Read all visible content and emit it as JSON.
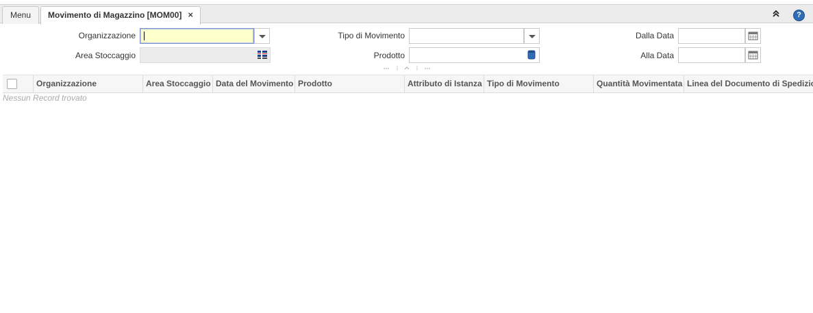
{
  "tabs": {
    "menu_label": "Menu",
    "active_label": "Movimento di Magazzino [MOM00]",
    "close_glyph": "×"
  },
  "window_controls": {
    "collapse_icon": "double-chevron-up-icon",
    "help_icon": "help-icon",
    "collapse_glyph": "»",
    "help_glyph": "?"
  },
  "form": {
    "organizzazione_label": "Organizzazione",
    "organizzazione_value": "",
    "area_stoccaggio_label": "Area Stoccaggio",
    "area_stoccaggio_value": "",
    "tipo_movimento_label": "Tipo di Movimento",
    "tipo_movimento_value": "",
    "prodotto_label": "Prodotto",
    "prodotto_value": "",
    "dalla_data_label": "Dalla Data",
    "dalla_data_value": "",
    "alla_data_label": "Alla Data",
    "alla_data_value": ""
  },
  "grid": {
    "columns": [
      "Organizzazione",
      "Area Stoccaggio",
      "Data del Movimento",
      "Prodotto",
      "Attributo di Istanza",
      "Tipo di Movimento",
      "Quantità Movimentata",
      "Linea del Documento di Spedizione"
    ],
    "empty_message": "Nessun Record trovato"
  },
  "colors": {
    "focused_field": "#ffffcc",
    "accent_blue": "#2f6db5"
  }
}
